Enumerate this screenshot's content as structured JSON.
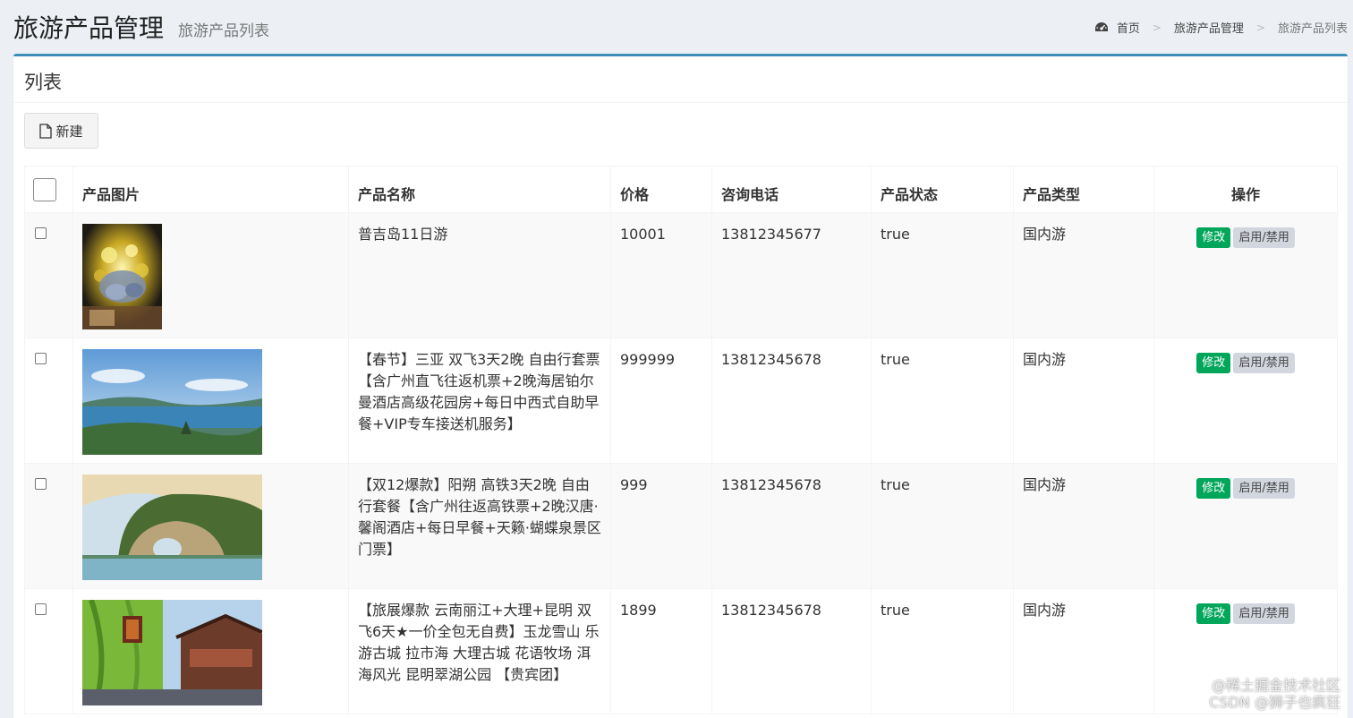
{
  "header": {
    "title": "旅游产品管理",
    "subtitle": "旅游产品列表"
  },
  "breadcrumb": {
    "icon": "dashboard-icon",
    "items": [
      "首页",
      "旅游产品管理",
      "旅游产品列表"
    ],
    "separator": ">"
  },
  "box": {
    "title": "列表",
    "new_button_label": "新建",
    "accent_color": "#3c8dbc"
  },
  "table": {
    "columns": [
      "产品图片",
      "产品名称",
      "价格",
      "咨询电话",
      "产品状态",
      "产品类型",
      "操作"
    ],
    "edit_label": "修改",
    "toggle_label": "启用/禁用",
    "edit_color": "#00a65a",
    "toggle_color": "#d2d6de",
    "rows": [
      {
        "image": "flower-bouquet-night-photo",
        "name": "普吉岛11日游",
        "price": "10001",
        "phone": "13812345677",
        "status": "true",
        "type": "国内游"
      },
      {
        "image": "sanya-bay-landscape-photo",
        "name": "【春节】三亚 双飞3天2晚 自由行套票【含广州直飞往返机票+2晚海居铂尔曼酒店高级花园房+每日中西式自助早餐+VIP专车接送机服务】",
        "price": "999999",
        "phone": "13812345678",
        "status": "true",
        "type": "国内游"
      },
      {
        "image": "yangshuo-elephant-trunk-hill-photo",
        "name": "【双12爆款】阳朔 高铁3天2晚 自由行套餐【含广州往返高铁票+2晚汉唐·馨阁酒店+每日早餐+天籁·蝴蝶泉景区门票】",
        "price": "999",
        "phone": "13812345678",
        "status": "true",
        "type": "国内游"
      },
      {
        "image": "lijiang-old-town-photo",
        "name": "【旅展爆款 云南丽江+大理+昆明 双飞6天★一价全包无自费】玉龙雪山 乐游古城 拉市海 大理古城 花语牧场 洱海风光 昆明翠湖公园 【贵宾团】",
        "price": "1899",
        "phone": "13812345678",
        "status": "true",
        "type": "国内游"
      }
    ]
  },
  "watermark": {
    "line1": "@稀土掘金技术社区",
    "line2": "CSDN @狮子也疯狂"
  }
}
